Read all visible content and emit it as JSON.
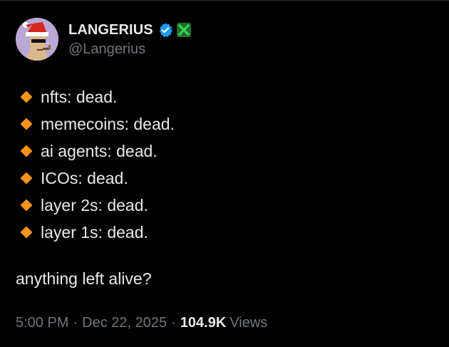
{
  "author": {
    "display_name": "LANGERIUS",
    "handle": "@Langerius",
    "verified_badge_color": "#1d9bf0",
    "affiliation_badge_color": "#39d353"
  },
  "tweet": {
    "items": [
      {
        "text": "nfts: dead."
      },
      {
        "text": "memecoins: dead."
      },
      {
        "text": "ai agents: dead."
      },
      {
        "text": "ICOs: dead."
      },
      {
        "text": "layer 2s: dead."
      },
      {
        "text": "layer 1s: dead."
      }
    ],
    "bullet_icon": "orange-diamond-emoji",
    "bullet_color": "#f7931a",
    "closing_text": "anything left alive?"
  },
  "meta": {
    "time": "5:00 PM",
    "separator": "·",
    "date": "Dec 22, 2025",
    "views_count": "104.9K",
    "views_label": "Views"
  }
}
